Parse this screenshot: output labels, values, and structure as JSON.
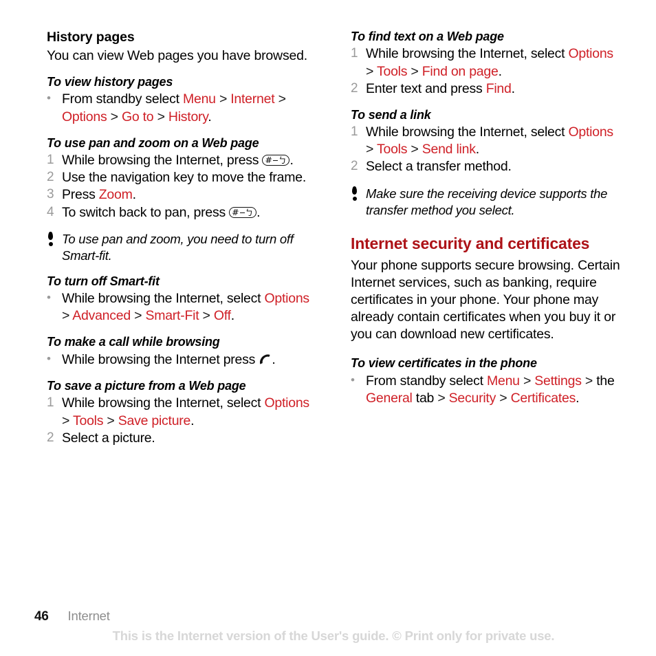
{
  "document": {
    "page_number": "46",
    "chapter": "Internet",
    "watermark": "This is the Internet version of the User's guide. © Print only for private use.",
    "colors": {
      "link_red": "#cf2027",
      "heading_red": "#ad1217",
      "marker_gray": "#9a9a9a",
      "watermark_gray": "#d7d7d7"
    }
  },
  "left_column": {
    "history": {
      "heading": "History pages",
      "body": "You can view Web pages you have browsed."
    },
    "view_history": {
      "heading": "To view history pages",
      "bullet": "•",
      "lead": "From standby select ",
      "links": [
        "Menu",
        "Internet",
        "Options",
        "Go to",
        "History"
      ],
      "sep": ">",
      "period": "."
    },
    "pan_zoom": {
      "heading": "To use pan and zoom on a Web page",
      "steps": [
        {
          "num": "1",
          "text_before": "While browsing the Internet, press ",
          "key": "#",
          "text_after": "."
        },
        {
          "num": "2",
          "text_before": "Use the navigation key to move the frame.",
          "key": "",
          "text_after": ""
        },
        {
          "num": "3",
          "text_before": "Press ",
          "link": "Zoom",
          "text_after": "."
        },
        {
          "num": "4",
          "text_before": "To switch back to pan, press ",
          "key": "#",
          "text_after": "."
        }
      ]
    },
    "note_smartfit": "To use pan and zoom, you need to turn off Smart-fit.",
    "turn_off_smartfit": {
      "heading": "To turn off Smart-fit",
      "bullet": "•",
      "lead": "While browsing the Internet, select ",
      "links": [
        "Options",
        "Advanced",
        "Smart-Fit",
        "Off"
      ],
      "sep": ">",
      "period": "."
    },
    "make_call": {
      "heading": "To make a call while browsing",
      "bullet": "•",
      "lead": "While browsing the Internet press ",
      "icon": "call-key-icon",
      "period": "."
    },
    "save_picture": {
      "heading": "To save a picture from a Web page",
      "steps": [
        {
          "num": "1",
          "lead": "While browsing the Internet, select ",
          "links": [
            "Options",
            "Tools",
            "Save picture"
          ],
          "period": "."
        },
        {
          "num": "2",
          "lead": "Select a picture.",
          "links": [],
          "period": ""
        }
      ]
    }
  },
  "right_column": {
    "find_text": {
      "heading": "To find text on a Web page",
      "steps": [
        {
          "num": "1",
          "lead": "While browsing the Internet, select ",
          "links": [
            "Options",
            "Tools",
            "Find on page"
          ],
          "period": "."
        },
        {
          "num": "2",
          "lead": "Enter text and press ",
          "links": [
            "Find"
          ],
          "period": "."
        }
      ]
    },
    "send_link": {
      "heading": "To send a link",
      "steps": [
        {
          "num": "1",
          "lead": "While browsing the Internet, select ",
          "links": [
            "Options",
            "Tools",
            "Send link"
          ],
          "period": "."
        },
        {
          "num": "2",
          "lead": "Select a transfer method.",
          "links": [],
          "period": ""
        }
      ]
    },
    "note_transfer": "Make sure the receiving device supports the transfer method you select.",
    "security": {
      "heading": "Internet security and certificates",
      "body": "Your phone supports secure browsing. Certain Internet services, such as banking, require certificates in your phone. Your phone may already contain certificates when you buy it or you can download new certificates."
    },
    "view_certificates": {
      "heading": "To view certificates in the phone",
      "bullet": "•",
      "lead": "From standby select ",
      "links": [
        "Menu",
        "Settings",
        "General",
        "Security",
        "Certificates"
      ],
      "the_word": "the",
      "tab_word": "tab",
      "sep": ">",
      "period": "."
    }
  }
}
